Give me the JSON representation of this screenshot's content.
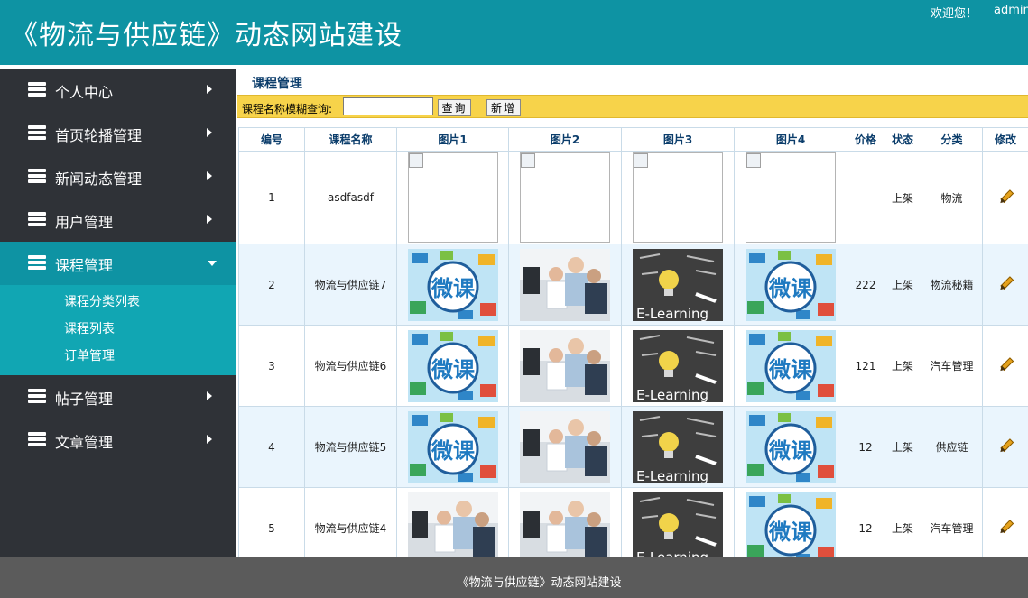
{
  "header": {
    "title": "《物流与供应链》动态网站建设",
    "welcome": "欢迎您！",
    "user": "admin"
  },
  "sidebar": {
    "items": [
      {
        "label": "个人中心"
      },
      {
        "label": "首页轮播管理"
      },
      {
        "label": "新闻动态管理"
      },
      {
        "label": "用户管理"
      },
      {
        "label": "课程管理",
        "active": true
      },
      {
        "label": "帖子管理"
      },
      {
        "label": "文章管理"
      }
    ],
    "submenu": [
      "课程分类列表",
      "课程列表",
      "订单管理"
    ]
  },
  "main": {
    "title": "课程管理",
    "search": {
      "label": "课程名称模糊查询:",
      "value": "",
      "query_button": "查询",
      "add_button": "新增"
    },
    "columns": [
      "编号",
      "课程名称",
      "图片1",
      "图片2",
      "图片3",
      "图片4",
      "价格",
      "状态",
      "分类",
      "修改"
    ],
    "rows": [
      {
        "id": "1",
        "name": "asdfasdf",
        "pics": [
          "broken",
          "broken",
          "broken",
          "broken"
        ],
        "price": "",
        "status": "上架",
        "category": "物流"
      },
      {
        "id": "2",
        "name": "物流与供应链7",
        "pics": [
          "weike",
          "people",
          "elearning",
          "weike"
        ],
        "price": "222",
        "status": "上架",
        "category": "物流秘籍"
      },
      {
        "id": "3",
        "name": "物流与供应链6",
        "pics": [
          "weike",
          "people",
          "elearning",
          "weike"
        ],
        "price": "121",
        "status": "上架",
        "category": "汽车管理"
      },
      {
        "id": "4",
        "name": "物流与供应链5",
        "pics": [
          "weike",
          "people",
          "elearning",
          "weike"
        ],
        "price": "12",
        "status": "上架",
        "category": "供应链"
      },
      {
        "id": "5",
        "name": "物流与供应链4",
        "pics": [
          "people",
          "people",
          "elearning",
          "weike"
        ],
        "price": "12",
        "status": "上架",
        "category": "汽车管理"
      }
    ],
    "image_text": {
      "weike": "微课",
      "elearning": "E-Learning"
    }
  },
  "footer": {
    "text": "《物流与供应链》动态网站建设"
  },
  "colors": {
    "header": "#0e93a3",
    "sidebar": "#2f3237",
    "submenu": "#11a6b3",
    "searchbar": "#f7d34a",
    "footer": "#5b5b5b"
  }
}
